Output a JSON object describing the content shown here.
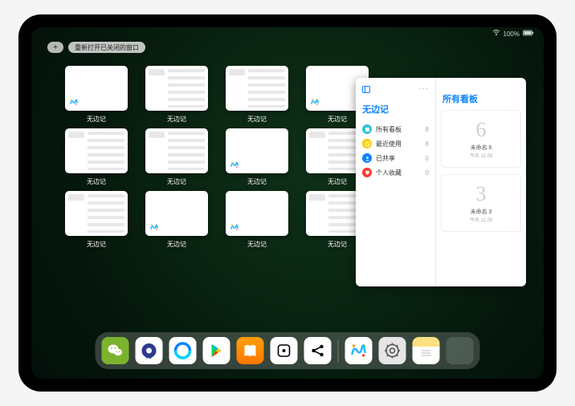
{
  "status": {
    "battery": "100%"
  },
  "toolbar": {
    "plus": "+",
    "reopen": "重新打开已关闭的窗口"
  },
  "expose": {
    "app_name": "无边记",
    "tiles": [
      {
        "style": "blank",
        "label": "无边记"
      },
      {
        "style": "content",
        "label": "无边记"
      },
      {
        "style": "content",
        "label": "无边记"
      },
      {
        "style": "blank",
        "label": "无边记"
      },
      {
        "style": "content",
        "label": "无边记"
      },
      {
        "style": "content",
        "label": "无边记"
      },
      {
        "style": "blank",
        "label": "无边记"
      },
      {
        "style": "content",
        "label": "无边记"
      },
      {
        "style": "content",
        "label": "无边记"
      },
      {
        "style": "blank",
        "label": "无边记"
      },
      {
        "style": "blank",
        "label": "无边记"
      },
      {
        "style": "content",
        "label": "无边记"
      }
    ]
  },
  "sidebar": {
    "title": "无边记",
    "items": [
      {
        "label": "所有看板",
        "count": "8",
        "color": "#30c3d6"
      },
      {
        "label": "最近使用",
        "count": "8",
        "color": "#ffcc00"
      },
      {
        "label": "已共享",
        "count": "0",
        "color": "#0a84ff"
      },
      {
        "label": "个人收藏",
        "count": "0",
        "color": "#ff3b30"
      }
    ]
  },
  "boards": {
    "title": "所有看板",
    "cards": [
      {
        "doodle": "6",
        "name": "未命名 6",
        "sub": "今天 11:29"
      },
      {
        "doodle": "3",
        "name": "未命名 3",
        "sub": "今天 11:28"
      }
    ]
  },
  "dock": {
    "apps": [
      {
        "id": "wechat"
      },
      {
        "id": "hd-browser"
      },
      {
        "id": "qq-browser"
      },
      {
        "id": "playstore"
      },
      {
        "id": "books"
      },
      {
        "id": "dice"
      },
      {
        "id": "share"
      }
    ],
    "recent": [
      {
        "id": "freeform"
      },
      {
        "id": "settings"
      },
      {
        "id": "notes"
      },
      {
        "id": "library"
      }
    ]
  }
}
